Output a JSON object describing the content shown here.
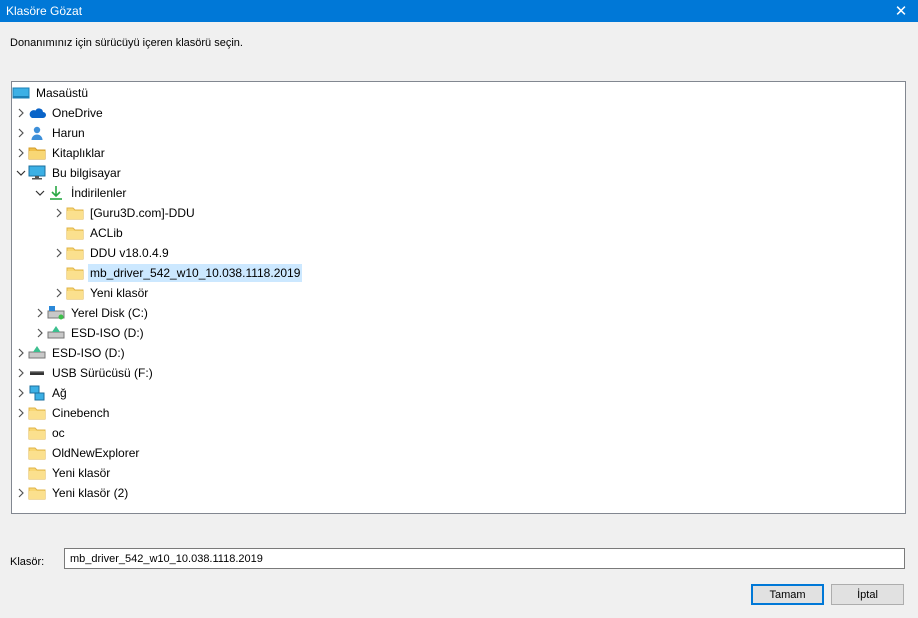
{
  "window": {
    "title": "Klasöre Gözat",
    "close_icon": "close-icon"
  },
  "instruction": "Donanımınız için sürücüyü içeren klasörü seçin.",
  "tree": [
    {
      "label": "Masaüstü",
      "icon": "desktop-icon",
      "level": 0,
      "expander": "none"
    },
    {
      "label": "OneDrive",
      "icon": "onedrive-icon",
      "level": 1,
      "expander": "collapsed"
    },
    {
      "label": "Harun",
      "icon": "user-icon",
      "level": 1,
      "expander": "collapsed"
    },
    {
      "label": "Kitaplıklar",
      "icon": "libraries-icon",
      "level": 1,
      "expander": "collapsed"
    },
    {
      "label": "Bu bilgisayar",
      "icon": "computer-icon",
      "level": 1,
      "expander": "expanded"
    },
    {
      "label": "İndirilenler",
      "icon": "downloads-icon",
      "level": 2,
      "expander": "expanded"
    },
    {
      "label": "[Guru3D.com]-DDU",
      "icon": "folder-icon",
      "level": 3,
      "expander": "collapsed"
    },
    {
      "label": "ACLib",
      "icon": "folder-icon",
      "level": 3,
      "expander": "none"
    },
    {
      "label": "DDU v18.0.4.9",
      "icon": "folder-icon",
      "level": 3,
      "expander": "collapsed"
    },
    {
      "label": "mb_driver_542_w10_10.038.1118.2019",
      "icon": "folder-icon",
      "level": 3,
      "expander": "none",
      "selected": true
    },
    {
      "label": "Yeni klasör",
      "icon": "folder-icon",
      "level": 3,
      "expander": "collapsed"
    },
    {
      "label": "Yerel Disk (C:)",
      "icon": "windows-drive-icon",
      "level": 2,
      "expander": "collapsed"
    },
    {
      "label": "ESD-ISO (D:)",
      "icon": "dvd-drive-icon",
      "level": 2,
      "expander": "collapsed"
    },
    {
      "label": "ESD-ISO (D:)",
      "icon": "dvd-drive-icon",
      "level": 1,
      "expander": "collapsed"
    },
    {
      "label": "USB Sürücüsü (F:)",
      "icon": "usb-drive-icon",
      "level": 1,
      "expander": "collapsed"
    },
    {
      "label": "Ağ",
      "icon": "network-icon",
      "level": 1,
      "expander": "collapsed"
    },
    {
      "label": "Cinebench",
      "icon": "folder-icon",
      "level": 1,
      "expander": "collapsed"
    },
    {
      "label": "oc",
      "icon": "folder-icon",
      "level": 1,
      "expander": "none"
    },
    {
      "label": "OldNewExplorer",
      "icon": "folder-icon",
      "level": 1,
      "expander": "none"
    },
    {
      "label": "Yeni klasör",
      "icon": "folder-icon",
      "level": 1,
      "expander": "none"
    },
    {
      "label": "Yeni klasör (2)",
      "icon": "folder-icon",
      "level": 1,
      "expander": "collapsed"
    }
  ],
  "folder_field": {
    "label": "Klasör:",
    "value": "mb_driver_542_w10_10.038.1118.2019"
  },
  "buttons": {
    "ok": "Tamam",
    "cancel": "İptal"
  },
  "colors": {
    "accent": "#0078d7",
    "selection": "#cce8ff",
    "folder": "#f8d775"
  }
}
